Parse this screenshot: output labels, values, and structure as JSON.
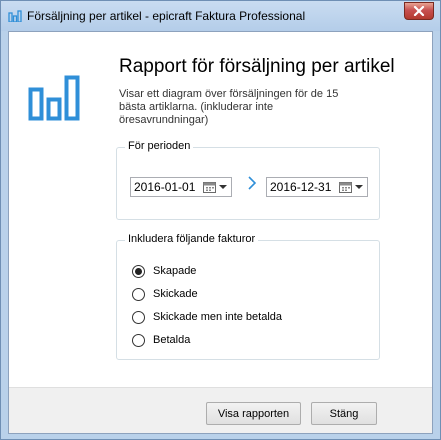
{
  "window": {
    "title": "Försäljning per artikel - epicraft Faktura Professional"
  },
  "header": {
    "heading": "Rapport för försäljning per artikel",
    "description": "Visar ett diagram över försäljningen för de 15 bästa artiklarna. (inkluderar inte öresavrundningar)"
  },
  "period": {
    "legend": "För perioden",
    "from_date": "2016-01-01",
    "to_date": "2016-12-31"
  },
  "invoices": {
    "legend": "Inkludera följande fakturor",
    "selected_index": 0,
    "options": [
      {
        "label": "Skapade"
      },
      {
        "label": "Skickade"
      },
      {
        "label": "Skickade men inte betalda"
      },
      {
        "label": "Betalda"
      }
    ]
  },
  "footer": {
    "show_report_label": "Visa rapporten",
    "close_label": "Stäng"
  },
  "colors": {
    "accent": "#2f8fd8",
    "titlebar": "#b9d1ea",
    "close_button": "#c75050"
  }
}
